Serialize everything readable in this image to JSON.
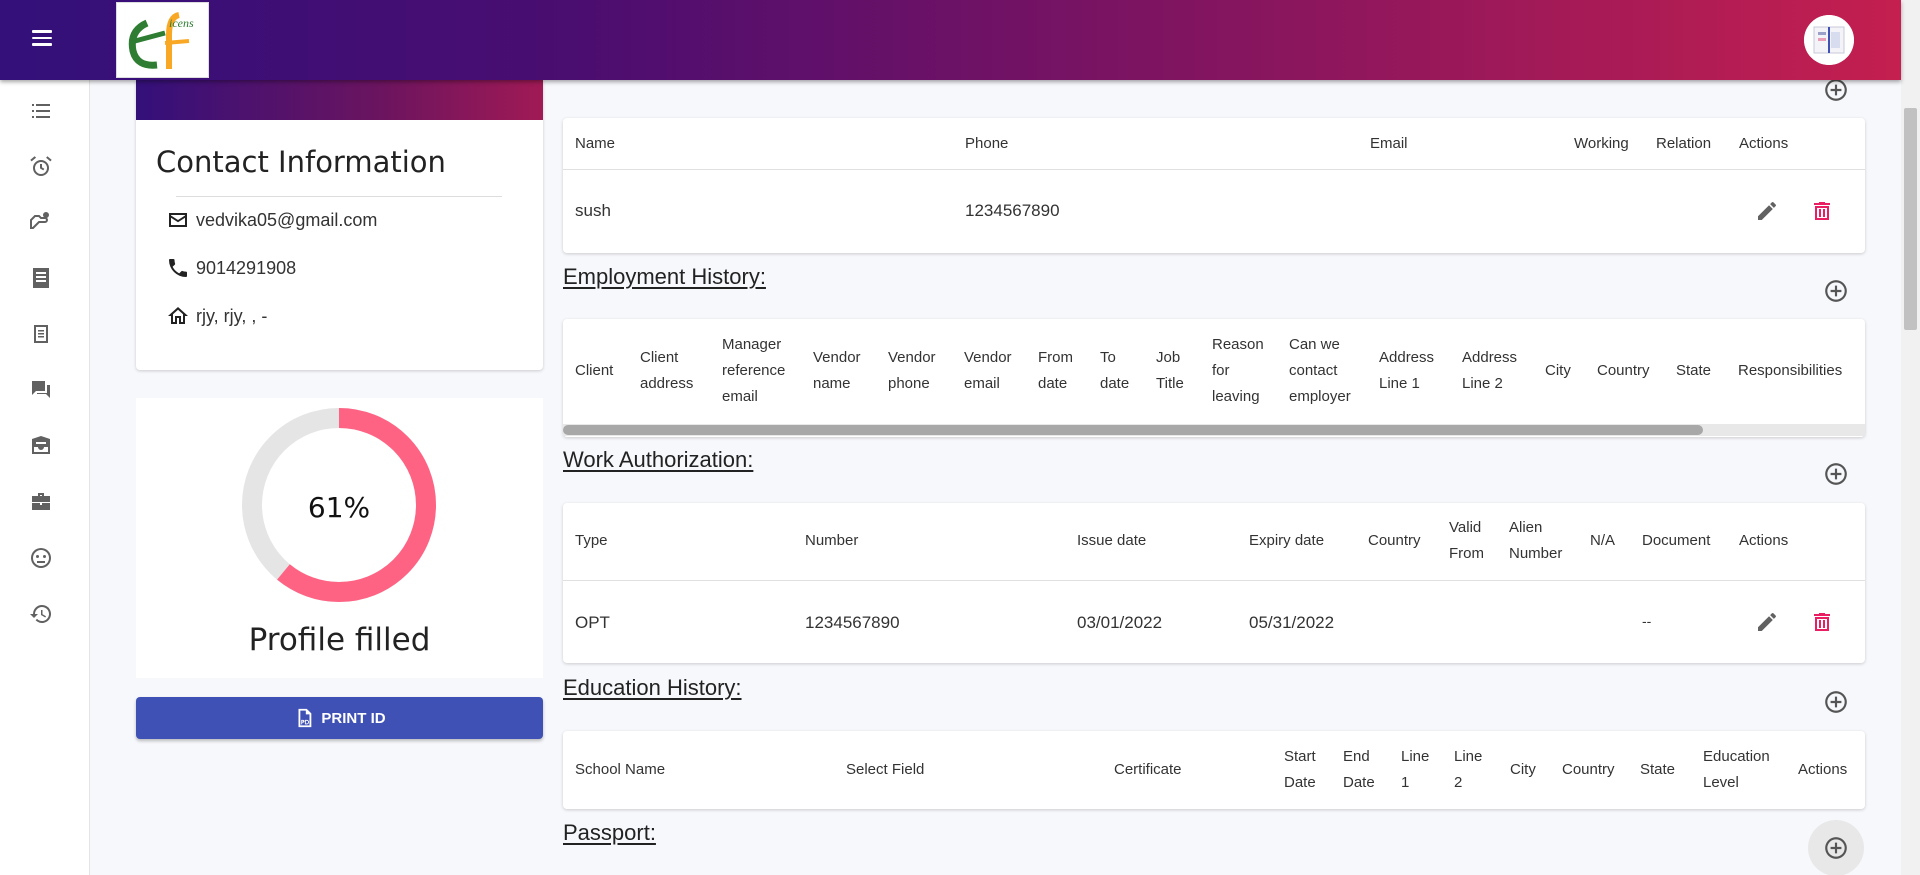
{
  "app": {
    "logo_text": "ef icens"
  },
  "contact": {
    "title": "Contact Information",
    "email": "vedvika05@gmail.com",
    "phone": "9014291908",
    "address": "rjy, rjy, , -"
  },
  "profile": {
    "percent_label": "61%",
    "percent": 61,
    "label": "Profile filled"
  },
  "print_label": "PRINT ID",
  "emergency": {
    "headers": [
      "Name",
      "Phone",
      "Email",
      "Working",
      "Relation",
      "Actions"
    ],
    "rows": [
      {
        "name": "sush",
        "phone": "1234567890"
      }
    ]
  },
  "employment": {
    "title": "Employment History:",
    "headers": [
      "Client",
      "Client address",
      "Manager reference email",
      "Vendor name",
      "Vendor phone",
      "Vendor email",
      "From date",
      "To date",
      "Job Title",
      "Reason for leaving",
      "Can we contact employer",
      "Address Line 1",
      "Address Line 2",
      "City",
      "Country",
      "State",
      "Responsibilities"
    ]
  },
  "work_auth": {
    "title": "Work Authorization:",
    "headers": [
      "Type",
      "Number",
      "Issue date",
      "Expiry date",
      "Country",
      "Valid From",
      "Alien Number",
      "N/A",
      "Document",
      "Actions"
    ],
    "rows": [
      {
        "type": "OPT",
        "number": "1234567890",
        "issue": "03/01/2022",
        "expiry": "05/31/2022",
        "document": "--"
      }
    ]
  },
  "education": {
    "title": "Education History:",
    "headers": [
      "School Name",
      "Select Field",
      "Certificate",
      "Start Date",
      "End Date",
      "Line 1",
      "Line 2",
      "City",
      "Country",
      "State",
      "Education Level",
      "Actions"
    ]
  },
  "passport": {
    "title": "Passport:"
  },
  "colors": {
    "accent": "#3f51b5",
    "delete": "#e91e63",
    "donut": "#ff6384",
    "donut_track": "#e5e5e5"
  }
}
